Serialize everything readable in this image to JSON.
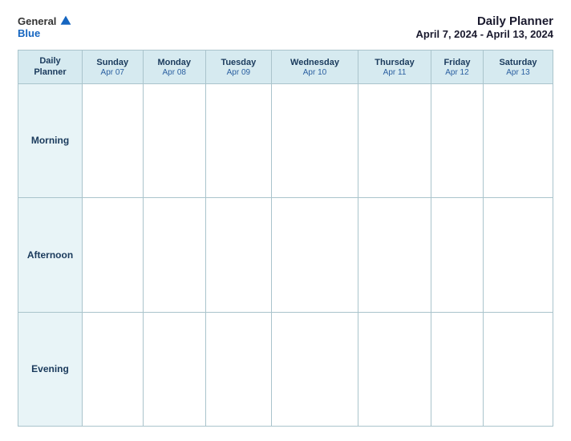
{
  "header": {
    "logo": {
      "general": "General",
      "blue": "Blue",
      "icon_label": "general-blue-logo"
    },
    "title": "Daily Planner",
    "date_range": "April 7, 2024 - April 13, 2024"
  },
  "table": {
    "header_row": {
      "label_col": {
        "line1": "Daily",
        "line2": "Planner"
      },
      "days": [
        {
          "name": "Sunday",
          "date": "Apr 07"
        },
        {
          "name": "Monday",
          "date": "Apr 08"
        },
        {
          "name": "Tuesday",
          "date": "Apr 09"
        },
        {
          "name": "Wednesday",
          "date": "Apr 10"
        },
        {
          "name": "Thursday",
          "date": "Apr 11"
        },
        {
          "name": "Friday",
          "date": "Apr 12"
        },
        {
          "name": "Saturday",
          "date": "Apr 13"
        }
      ]
    },
    "rows": [
      {
        "label": "Morning"
      },
      {
        "label": "Afternoon"
      },
      {
        "label": "Evening"
      }
    ]
  }
}
